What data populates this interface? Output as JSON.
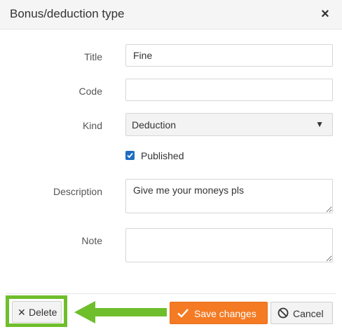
{
  "dialog": {
    "title": "Bonus/deduction type",
    "close_icon": "close-icon"
  },
  "form": {
    "title_label": "Title",
    "title_value": "Fine",
    "code_label": "Code",
    "code_value": "",
    "kind_label": "Kind",
    "kind_value": "Deduction",
    "published_label": "Published",
    "published_checked": true,
    "description_label": "Description",
    "description_value": "Give me your moneys pls",
    "note_label": "Note",
    "note_value": ""
  },
  "footer": {
    "delete_label": "Delete",
    "save_label": "Save changes",
    "cancel_label": "Cancel"
  },
  "colors": {
    "save_button": "#f47b24",
    "highlight": "#6fbe2c",
    "checkbox": "#1f6dc1"
  }
}
